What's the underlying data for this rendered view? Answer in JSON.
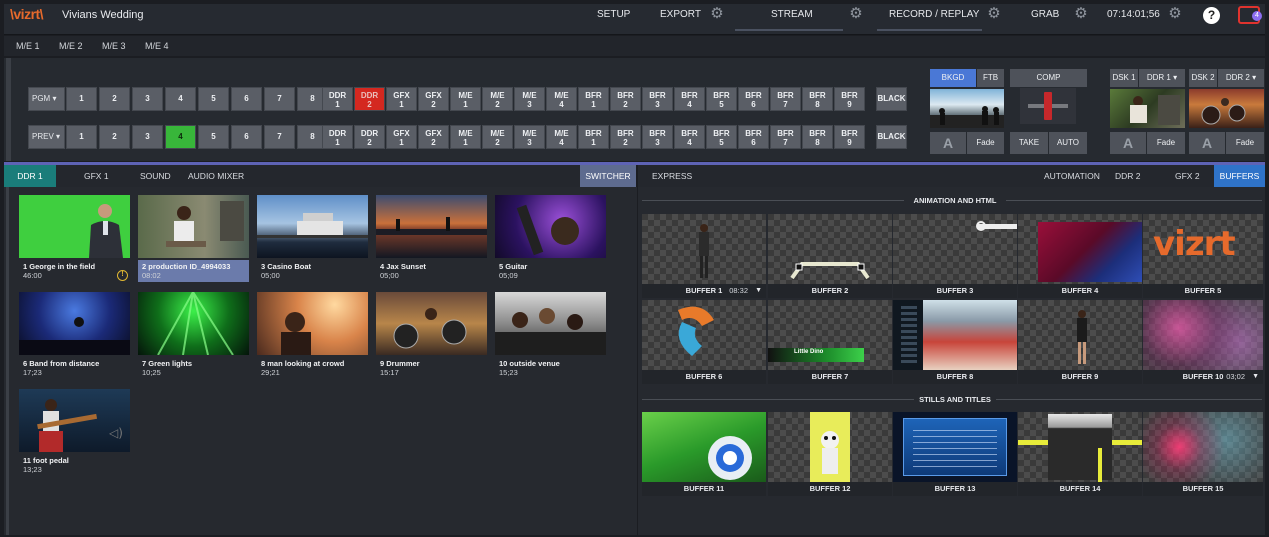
{
  "app": {
    "logo": "\\vizrt\\",
    "session": "Vivians Wedding"
  },
  "topmenu": {
    "setup": "SETUP",
    "export": "EXPORT",
    "stream": "STREAM",
    "record": "RECORD / REPLAY",
    "grab": "GRAB",
    "time": "07:14:01;56",
    "help": "?",
    "notifications": "4"
  },
  "me_tabs": [
    "M/E 1",
    "M/E 2",
    "M/E 3",
    "M/E 4"
  ],
  "switcher": {
    "pgm_label": "PGM ▾",
    "prev_label": "PREV ▾",
    "numbers": [
      "1",
      "2",
      "3",
      "4",
      "5",
      "6",
      "7",
      "8"
    ],
    "sources": [
      [
        "DDR",
        "1"
      ],
      [
        "DDR",
        "2"
      ],
      [
        "GFX",
        "1"
      ],
      [
        "GFX",
        "2"
      ],
      [
        "M/E",
        "1"
      ],
      [
        "M/E",
        "2"
      ],
      [
        "M/E",
        "3"
      ],
      [
        "M/E",
        "4"
      ],
      [
        "BFR",
        "1"
      ],
      [
        "BFR",
        "2"
      ],
      [
        "BFR",
        "3"
      ],
      [
        "BFR",
        "4"
      ],
      [
        "BFR",
        "5"
      ],
      [
        "BFR",
        "6"
      ],
      [
        "BFR",
        "7"
      ],
      [
        "BFR",
        "8"
      ],
      [
        "BFR",
        "9"
      ]
    ],
    "black": "BLACK",
    "pgm_selected": "DDR 2",
    "prev_selected": "4",
    "bkgd": "BKGD",
    "ftb": "FTB",
    "comp": "COMP",
    "take": "TAKE",
    "auto": "AUTO",
    "fade": "Fade",
    "dsk1": "DSK 1",
    "dsk1_src": "DDR 1 ▾",
    "dsk2": "DSK 2",
    "dsk2_src": "DDR 2 ▾",
    "dsk_letter": "A"
  },
  "left_tabs": {
    "ddr1": "DDR 1",
    "gfx1": "GFX 1",
    "sound": "SOUND",
    "mixer": "AUDIO MIXER",
    "switcher": "SWITCHER"
  },
  "right_tabs": {
    "express": "EXPRESS",
    "automation": "AUTOMATION",
    "ddr2": "DDR 2",
    "gfx2": "GFX 2",
    "buffers": "BUFFERS"
  },
  "clips": [
    {
      "title": "1 George in the field",
      "dur": "46:00"
    },
    {
      "title": "2 production ID_4994033",
      "dur": "08:02"
    },
    {
      "title": "3 Casino Boat",
      "dur": "05;00"
    },
    {
      "title": "4 Jax Sunset",
      "dur": "05;00"
    },
    {
      "title": "5 Guitar",
      "dur": "05;09"
    },
    {
      "title": "6 Band from distance",
      "dur": "17;23"
    },
    {
      "title": "7 Green lights",
      "dur": "10;25"
    },
    {
      "title": "8 man looking at crowd",
      "dur": "29;21"
    },
    {
      "title": "9 Drummer",
      "dur": "15:17"
    },
    {
      "title": "10 outside venue",
      "dur": "15;23"
    },
    {
      "title": "11 foot pedal",
      "dur": "13;23"
    }
  ],
  "buffers": {
    "section1": "ANIMATION AND HTML",
    "section2": "STILLS AND TITLES",
    "items": [
      {
        "label": "BUFFER 1",
        "time": "08:32"
      },
      {
        "label": "BUFFER 2"
      },
      {
        "label": "BUFFER 3"
      },
      {
        "label": "BUFFER 4"
      },
      {
        "label": "BUFFER 5"
      },
      {
        "label": "BUFFER 6"
      },
      {
        "label": "BUFFER 7"
      },
      {
        "label": "BUFFER 8"
      },
      {
        "label": "BUFFER 9"
      },
      {
        "label": "BUFFER 10",
        "time": "03;02"
      },
      {
        "label": "BUFFER 11"
      },
      {
        "label": "BUFFER 12"
      },
      {
        "label": "BUFFER 13"
      },
      {
        "label": "BUFFER 14"
      },
      {
        "label": "BUFFER 15"
      }
    ],
    "vizrt_logo": "vizrt",
    "buffer7_text": "Little Dino"
  }
}
